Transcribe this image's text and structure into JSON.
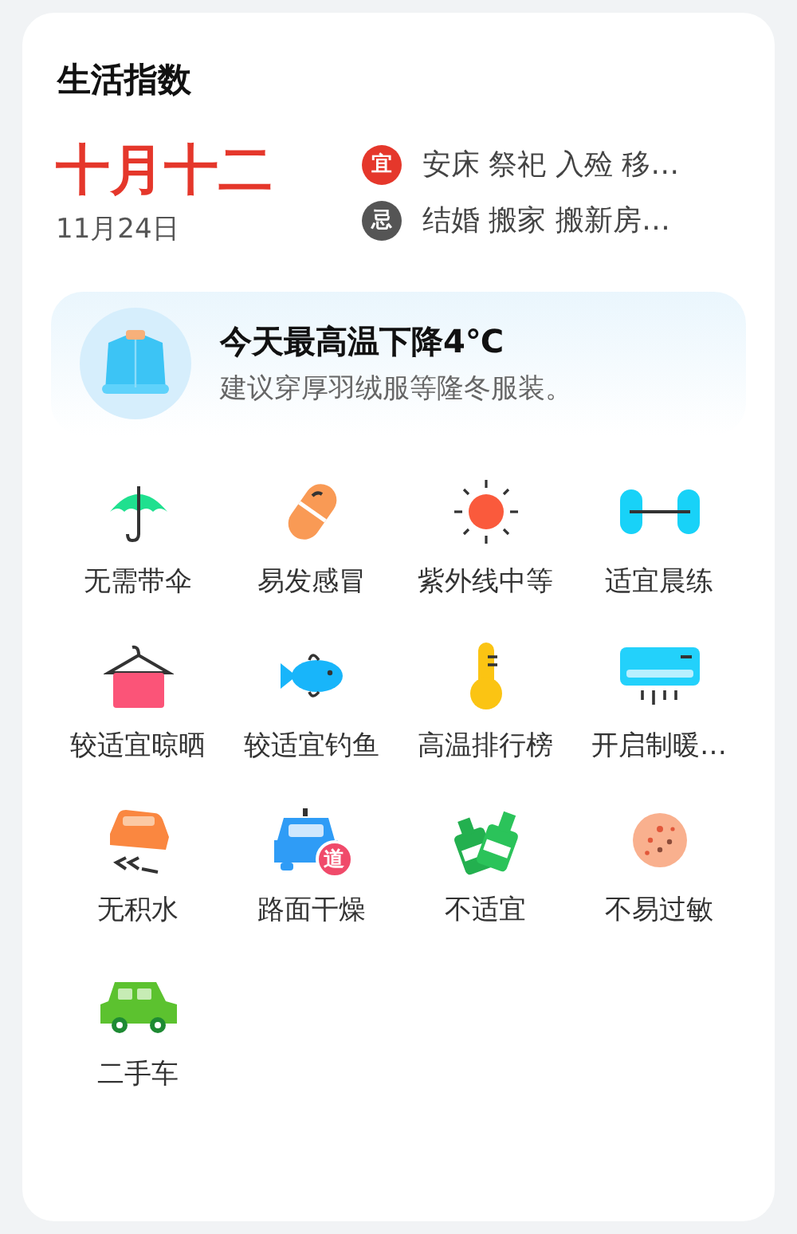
{
  "title": "生活指数",
  "lunar_date": "十月十二",
  "solar_date": "11月24日",
  "almanac": [
    {
      "kind": "good",
      "badge": "宜",
      "text": "安床 祭祀 入殓 移…"
    },
    {
      "kind": "bad",
      "badge": "忌",
      "text": "结婚 搬家 搬新房…"
    }
  ],
  "tip": {
    "headline": "今天最高温下降4℃",
    "advice": "建议穿厚羽绒服等隆冬服装。"
  },
  "indices": [
    {
      "kind": "umbrella",
      "label": "无需带伞"
    },
    {
      "kind": "pill",
      "label": "易发感冒"
    },
    {
      "kind": "sun",
      "label": "紫外线中等"
    },
    {
      "kind": "dumbbell",
      "label": "适宜晨练"
    },
    {
      "kind": "hanger",
      "label": "较适宜晾晒"
    },
    {
      "kind": "fish",
      "label": "较适宜钓鱼"
    },
    {
      "kind": "thermometer",
      "label": "高温排行榜"
    },
    {
      "kind": "aircon",
      "label": "开启制暖…"
    },
    {
      "kind": "skidcar",
      "label": "无积水"
    },
    {
      "kind": "roadcar",
      "label": "路面干燥",
      "badge": "道"
    },
    {
      "kind": "bottles",
      "label": "不适宜"
    },
    {
      "kind": "allergy",
      "label": "不易过敏"
    },
    {
      "kind": "car",
      "label": "二手车"
    }
  ]
}
